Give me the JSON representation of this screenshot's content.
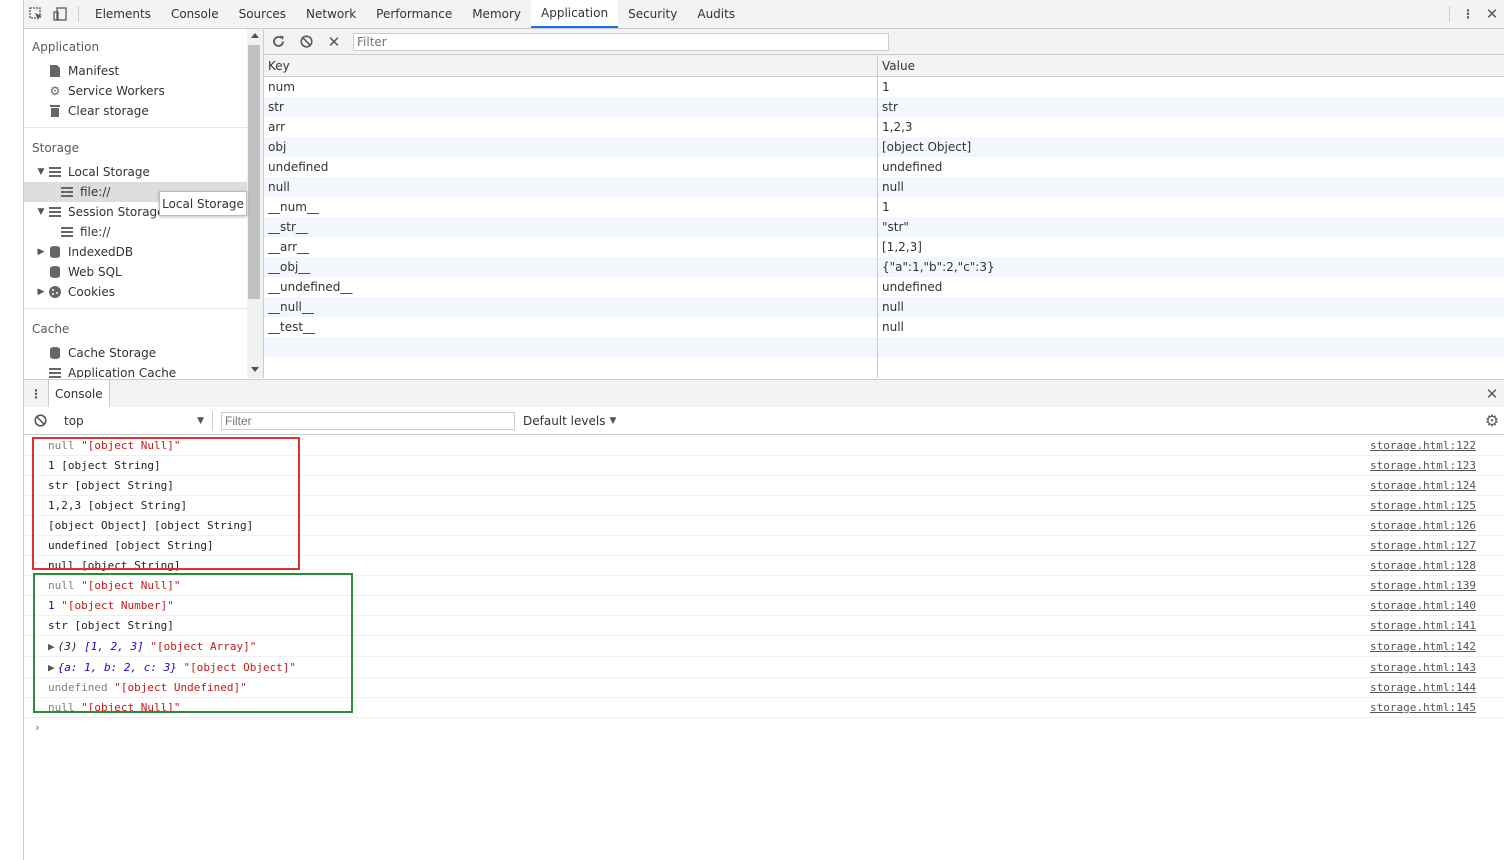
{
  "topbar": {
    "tabs": [
      "Elements",
      "Console",
      "Sources",
      "Network",
      "Performance",
      "Memory",
      "Application",
      "Security",
      "Audits"
    ],
    "active_tab": "Application"
  },
  "sidebar": {
    "application": {
      "title": "Application",
      "items": [
        "Manifest",
        "Service Workers",
        "Clear storage"
      ]
    },
    "storage": {
      "title": "Storage",
      "local_storage": "Local Storage",
      "local_file": "file://",
      "session_storage": "Session Storage",
      "session_file": "file://",
      "indexeddb": "IndexedDB",
      "websql": "Web SQL",
      "cookies": "Cookies"
    },
    "cache": {
      "title": "Cache",
      "cache_storage": "Cache Storage",
      "app_cache": "Application Cache"
    }
  },
  "tooltip": "Local Storage",
  "storage_view": {
    "filter_placeholder": "Filter",
    "columns": {
      "key": "Key",
      "value": "Value"
    },
    "rows": [
      {
        "k": "num",
        "v": "1"
      },
      {
        "k": "str",
        "v": "str"
      },
      {
        "k": "arr",
        "v": "1,2,3"
      },
      {
        "k": "obj",
        "v": "[object Object]"
      },
      {
        "k": "undefined",
        "v": "undefined"
      },
      {
        "k": "null",
        "v": "null"
      },
      {
        "k": "__num__",
        "v": "1"
      },
      {
        "k": "__str__",
        "v": "\"str\""
      },
      {
        "k": "__arr__",
        "v": "[1,2,3]"
      },
      {
        "k": "__obj__",
        "v": "{\"a\":1,\"b\":2,\"c\":3}"
      },
      {
        "k": "__undefined__",
        "v": "undefined"
      },
      {
        "k": "__null__",
        "v": "null"
      },
      {
        "k": "__test__",
        "v": "null"
      }
    ]
  },
  "drawer": {
    "tab": "Console"
  },
  "console": {
    "context": "top",
    "filter_placeholder": "Filter",
    "levels": "Default levels",
    "group1": [
      {
        "a": "null",
        "b": "\"[object Null]\"",
        "src": "storage.html:122",
        "style": "graynull"
      },
      {
        "a": "1 [object String]",
        "src": "storage.html:123"
      },
      {
        "a": "str [object String]",
        "src": "storage.html:124"
      },
      {
        "a": "1,2,3 [object String]",
        "src": "storage.html:125"
      },
      {
        "a": "[object Object] [object String]",
        "src": "storage.html:126"
      },
      {
        "a": "undefined [object String]",
        "src": "storage.html:127"
      },
      {
        "a": "null [object String]",
        "src": "storage.html:128"
      }
    ],
    "group2": {
      "l1": {
        "a": "null",
        "b": "\"[object Null]\"",
        "src": "storage.html:139"
      },
      "l2": {
        "a": "1",
        "b": "\"[object Number]\"",
        "src": "storage.html:140"
      },
      "l3": {
        "a": "str [object String]",
        "src": "storage.html:141"
      },
      "l4": {
        "pre": "(3) ",
        "arr": "[1, 2, 3]",
        "b": "\"[object Array]\"",
        "src": "storage.html:142"
      },
      "l5": {
        "obj": "{a: 1, b: 2, c: 3}",
        "b": "\"[object Object]\"",
        "src": "storage.html:143"
      },
      "l6": {
        "a": "undefined",
        "b": "\"[object Undefined]\"",
        "src": "storage.html:144"
      },
      "l7": {
        "a": "null",
        "b": "\"[object Null]\"",
        "src": "storage.html:145"
      }
    }
  },
  "colors": {
    "active_tab": "#1a73e8",
    "red_box": "#e03030",
    "green_box": "#2e8b3a",
    "string_red": "#c41a16",
    "number_blue": "#1c00cf"
  }
}
